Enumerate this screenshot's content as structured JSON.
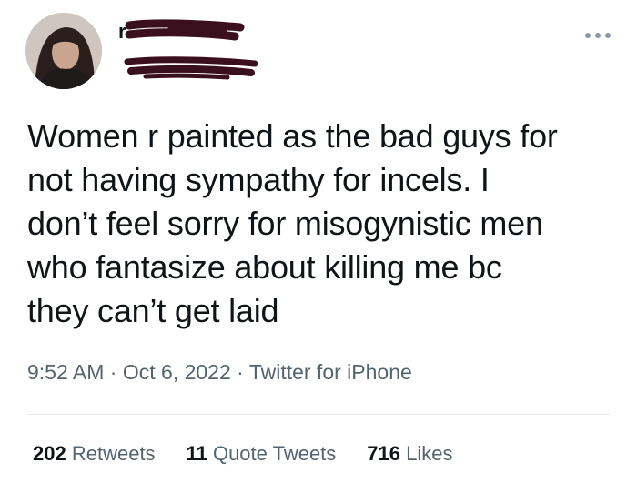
{
  "author": {
    "display_name": "",
    "handle": ""
  },
  "tweet": {
    "text_lines": [
      "Women r painted as the bad guys for",
      "not having sympathy for incels. I",
      "don’t feel sorry for misogynistic men",
      "who fantasize about killing me bc",
      "they can’t get laid"
    ],
    "time": "9:52 AM",
    "sep1": "·",
    "date": "Oct 6, 2022",
    "sep2": "·",
    "source": "Twitter for iPhone"
  },
  "stats": {
    "retweets_count": "202",
    "retweets_label": "Retweets",
    "quotes_count": "11",
    "quotes_label": "Quote Tweets",
    "likes_count": "716",
    "likes_label": "Likes"
  },
  "icons": {
    "more": "more-horizontal-icon",
    "avatar": "profile-photo"
  },
  "colors": {
    "text": "#0f1419",
    "secondary": "#536471",
    "redaction": "#3a0f1e",
    "divider": "#e6ecf0"
  }
}
